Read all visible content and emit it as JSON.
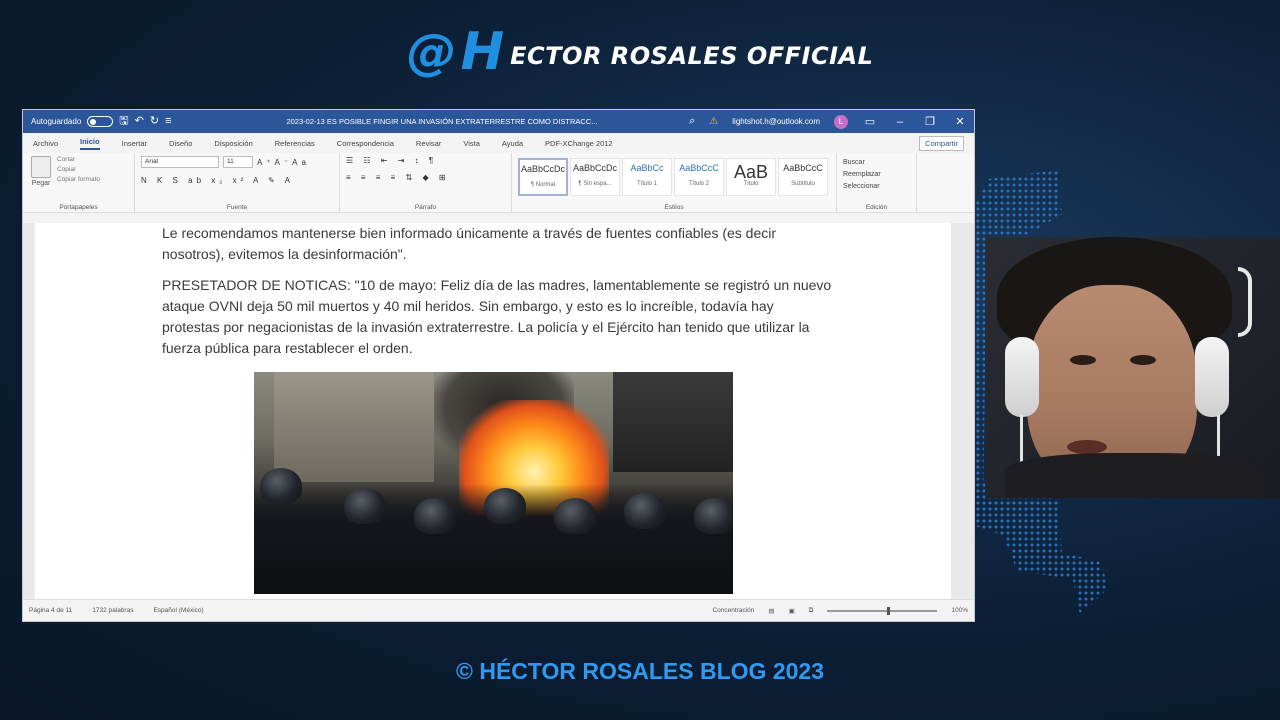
{
  "banner": {
    "at": "@",
    "h": "H",
    "text": "ECTOR ROSALES OFFICIAL"
  },
  "word": {
    "titlebar": {
      "autosave_label": "Autoguardado",
      "doc_title": "2023-02-13 ES POSIBLE FINGIR UNA INVASIÓN EXTRATERRESTRE COMO DISTRACC...",
      "account": "lightshot.h@outlook.com",
      "avatar_initial": "L"
    },
    "tabs": [
      "Archivo",
      "Inicio",
      "Insertar",
      "Diseño",
      "Disposición",
      "Referencias",
      "Correspondencia",
      "Revisar",
      "Vista",
      "Ayuda",
      "PDF-XChange 2012"
    ],
    "active_tab": "Inicio",
    "share_label": "Compartir",
    "ribbon": {
      "clipboard": {
        "paste": "Pegar",
        "cut": "Cortar",
        "copy": "Copiar",
        "format_painter": "Copiar formato",
        "label": "Portapapeles"
      },
      "font": {
        "font_name": "Arial",
        "font_size": "11",
        "label": "Fuente"
      },
      "paragraph": {
        "label": "Párrafo"
      },
      "styles": {
        "items": [
          {
            "sample": "AaBbCcDc",
            "name": "¶ Normal"
          },
          {
            "sample": "AaBbCcDc",
            "name": "¶ Sin espa..."
          },
          {
            "sample": "AaBbCc",
            "name": "Título 1"
          },
          {
            "sample": "AaBbCcC",
            "name": "Título 2"
          },
          {
            "sample": "AaB",
            "name": "Título"
          },
          {
            "sample": "AaBbCcC",
            "name": "Subtítulo"
          }
        ],
        "label": "Estilos"
      },
      "editing": {
        "find": "Buscar",
        "replace": "Reemplazar",
        "select": "Seleccionar",
        "label": "Edición"
      }
    },
    "document": {
      "para1": "Le recomendamos mantenerse bien informado únicamente a través de fuentes confiables (es decir nosotros), evitemos la desinformación\".",
      "para2": "PRESETADOR DE NOTICAS: \"10 de mayo: Feliz día de las madres, lamentablemente se registró un nuevo ataque OVNI deja 50 mil muertos y 40 mil heridos. Sin embargo, y esto es lo increíble, todavía hay protestas por negacionistas de la invasión extraterrestre. La policía y el Ejército han tenido que utilizar la fuerza pública para restablecer el orden."
    },
    "statusbar": {
      "page": "Página 4 de 11",
      "words": "1732 palabras",
      "language": "Español (México)",
      "focus": "Concentración",
      "zoom": "100%"
    }
  },
  "footer": {
    "text": "© HÉCTOR ROSALES BLOG 2023"
  },
  "colors": {
    "accent": "#1f8fe0",
    "word_blue": "#2b579a",
    "footer": "#2f9af0"
  }
}
